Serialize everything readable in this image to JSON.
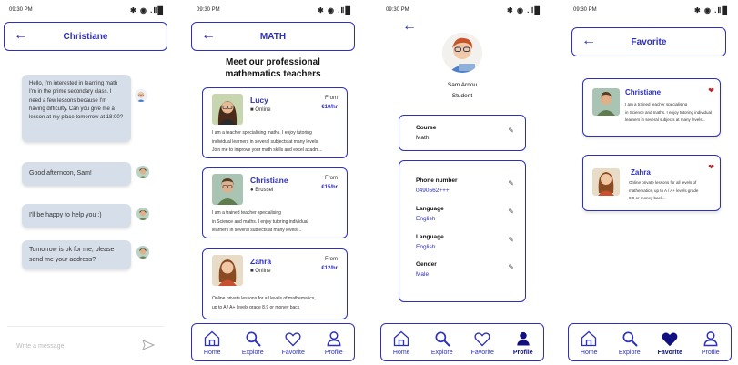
{
  "status": {
    "time": "09:30 PM",
    "icons": "✱ ◉ .Ⅱ█"
  },
  "chat": {
    "title": "Christiane",
    "messages": [
      "Hello, I'm interested in learning math I'm in the prime secondary class. I need a few lessons because I'm having difficulty. Can you give me a lesson at my place tomorrow at 18:00?",
      "Good afternoon, Sam!",
      "I'll be happy to help you :)",
      "Tomorrow is ok for me; please send me your address?"
    ],
    "input_placeholder": "Write a message"
  },
  "teachers": {
    "title": "MATH",
    "heading": "Meet our professional mathematics teachers",
    "cards": [
      {
        "name": "Lucy",
        "location": "Online",
        "from": "From",
        "price": "€10/hr",
        "desc": [
          "I am a teacher specialising maths. I enjoy tutoring",
          "individual learners in several subjects at many levels.",
          "Join me to improve your math skills and excel acadm..."
        ]
      },
      {
        "name": "Christiane",
        "location": "Brussel",
        "from": "From",
        "price": "€15/hr",
        "desc": [
          "I am a trained teacher specialising",
          "in Science and maths. I enjoy tutoring individual",
          "learners in several subjects at many levels..."
        ]
      },
      {
        "name": "Zahra",
        "location": "Online",
        "from": "From",
        "price": "€12/hr",
        "desc": [
          "Online private lessons for all levels of mathematics,",
          "up to A / A+ levels grade 8,9 or money back"
        ]
      }
    ]
  },
  "profile": {
    "name": "Sam Arnou",
    "role": "Student",
    "course_label": "Course",
    "course_value": "Math",
    "fields": [
      {
        "label": "Phone number",
        "value": "0490562+++"
      },
      {
        "label": "Language",
        "value": "English"
      },
      {
        "label": "Language",
        "value": "English"
      },
      {
        "label": "Gender",
        "value": "Male"
      }
    ]
  },
  "favorites": {
    "title": "Favorite",
    "cards": [
      {
        "name": "Christiane",
        "desc": [
          "I am a trained teacher specialising",
          "in Science and maths. I enjoy tutoring individual",
          "learners in several subjects at many levels..."
        ]
      },
      {
        "name": "Zahra",
        "desc": [
          "Online private lessons for all levels of",
          "mathematics, up to A / A+ levels grade",
          "8,9 or money back..."
        ]
      }
    ]
  },
  "nav": {
    "home": "Home",
    "explore": "Explore",
    "favorite": "Favorite",
    "profile": "Profile"
  },
  "colors": {
    "accent": "#2d2fbf",
    "bubble": "#d6dfe9",
    "heart": "#c0262d"
  }
}
